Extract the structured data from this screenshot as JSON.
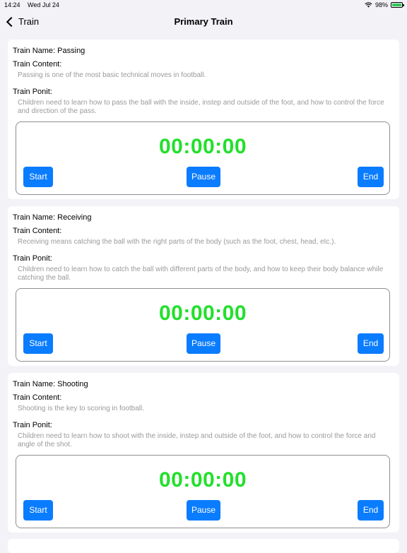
{
  "status_bar": {
    "time": "14:24",
    "date": "Wed Jul 24",
    "battery_percent": "98%",
    "battery_level": 0.98,
    "wifi_icon": "wifi-icon",
    "charging_icon": "bolt-icon"
  },
  "nav": {
    "back_label": "Train",
    "title": "Primary Train"
  },
  "labels": {
    "content": "Train Content:",
    "point": "Train Ponit:"
  },
  "cards": [
    {
      "name": "Train Name: Passing",
      "content": "Passing is one of the most basic technical moves in football.",
      "point": "Children need to learn how to pass the ball with the inside, instep and outside of the foot, and how to control the force and direction of the pass.",
      "timer": "00:00:00",
      "start": "Start",
      "pause": "Pause",
      "end": "End"
    },
    {
      "name": "Train Name: Receiving",
      "content": "Receiving means catching the ball with the right parts of the body (such as the foot, chest, head, etc.).",
      "point": "Children need to learn how to catch the ball with different parts of the body, and how to keep their body balance while catching the ball.",
      "timer": "00:00:00",
      "start": "Start",
      "pause": "Pause",
      "end": "End"
    },
    {
      "name": "Train Name: Shooting",
      "content": "Shooting is the key to scoring in football.",
      "point": "Children need to learn how to shoot with the inside, instep and outside of the foot, and how to control the force and angle of the shot.",
      "timer": "00:00:00",
      "start": "Start",
      "pause": "Pause",
      "end": "End"
    }
  ],
  "colors": {
    "timer": "#22e02c",
    "button": "#0a7cff",
    "muted_text": "#9a9a9a",
    "background": "#f2f2f7"
  }
}
